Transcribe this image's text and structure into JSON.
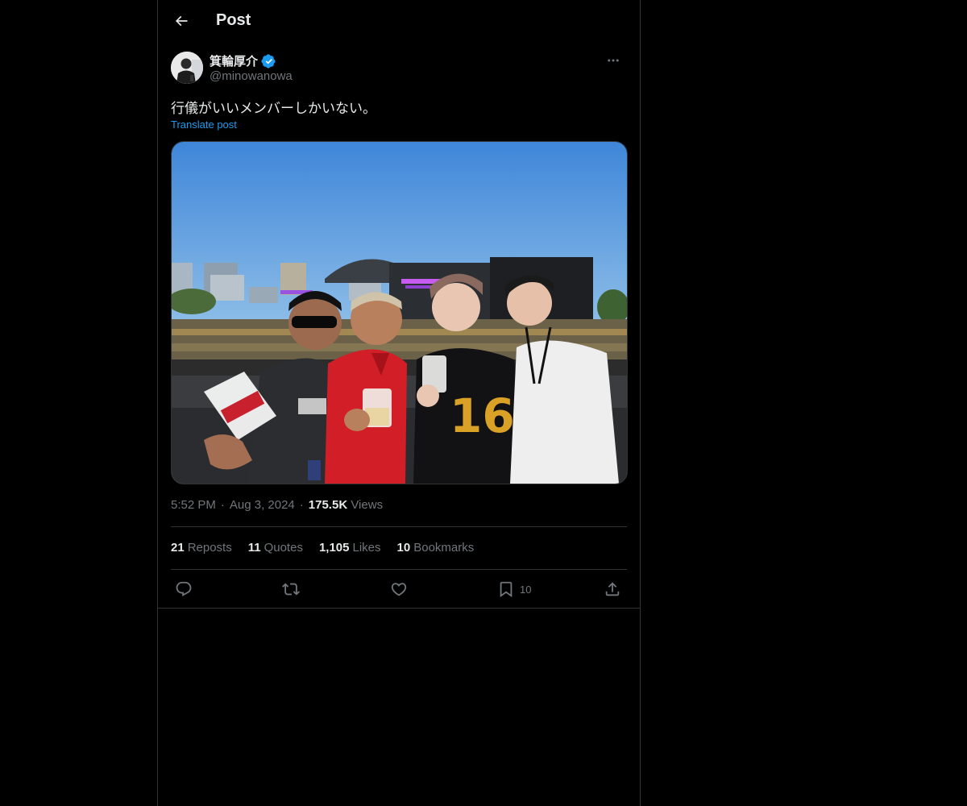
{
  "header": {
    "title": "Post"
  },
  "author": {
    "display_name": "箕輪厚介",
    "handle": "@minowanowa",
    "verified": true
  },
  "post": {
    "text": "行儀がいいメンバーしかいない。",
    "translate_label": "Translate post"
  },
  "meta": {
    "time": "5:52 PM",
    "date": "Aug 3, 2024",
    "views_count": "175.5K",
    "views_label": "Views"
  },
  "stats": {
    "reposts_count": "21",
    "reposts_label": "Reposts",
    "quotes_count": "11",
    "quotes_label": "Quotes",
    "likes_count": "1,105",
    "likes_label": "Likes",
    "bookmarks_count": "10",
    "bookmarks_label": "Bookmarks"
  },
  "actions": {
    "bookmark_count": "10"
  },
  "icons": [
    "back-arrow-icon",
    "verified-badge-icon",
    "more-icon",
    "reply-icon",
    "repost-icon",
    "like-icon",
    "bookmark-icon",
    "share-icon"
  ],
  "colors": {
    "background": "#000000",
    "text": "#e7e9ea",
    "muted": "#71767b",
    "accent": "#1d9bf0",
    "border": "#2f3336"
  }
}
